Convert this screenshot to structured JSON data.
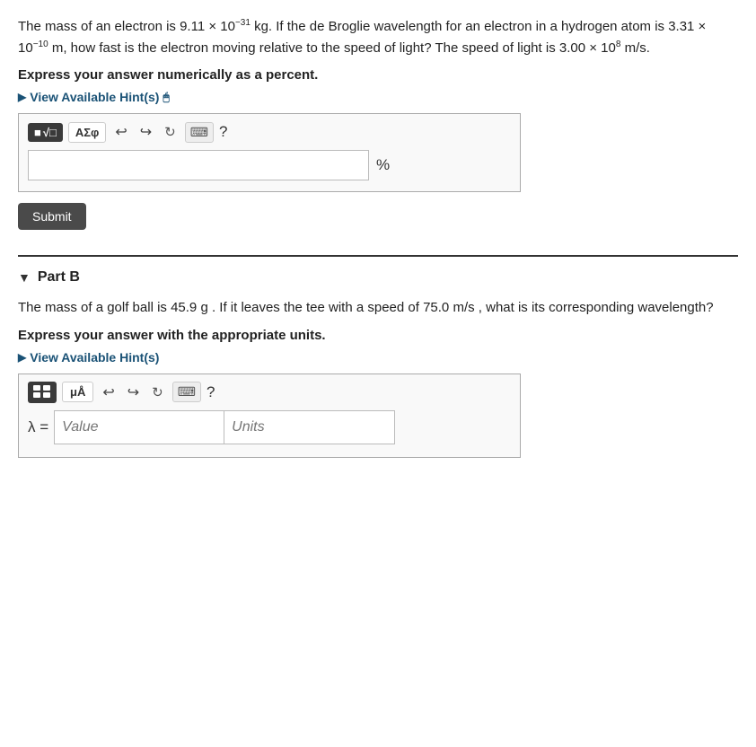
{
  "partA": {
    "problem_text_1": "The mass of an electron is 9.11 × 10",
    "exponent_1": "−31",
    "problem_text_2": " kg. If the de Broglie wavelength for an electron in a hydrogen atom is 3.31 × 10",
    "exponent_2": "−10",
    "problem_text_3": " m, how fast is the electron moving relative to the speed of light? The speed of light is 3.00 × 10",
    "exponent_3": "8",
    "problem_text_4": " m/s.",
    "instruction": "Express your answer numerically as a percent.",
    "hint_label": "View Available Hint(s)",
    "toolbar": {
      "sqrt_label": "√□",
      "greek_label": "ΑΣφ",
      "undo_icon": "↩",
      "redo_icon": "↪",
      "refresh_icon": "↻",
      "keyboard_icon": "⌨",
      "help_icon": "?"
    },
    "unit_symbol": "%",
    "submit_label": "Submit"
  },
  "partB": {
    "part_label": "Part B",
    "problem_text": "The mass of a golf ball is 45.9 g . If it leaves the tee with a speed of 75.0 m/s , what is its corresponding wavelength?",
    "instruction": "Express your answer with the appropriate units.",
    "hint_label": "View Available Hint(s)",
    "toolbar": {
      "matrix_icon": "grid",
      "mua_label": "μÅ",
      "undo_icon": "↩",
      "redo_icon": "↪",
      "refresh_icon": "↻",
      "keyboard_icon": "⌨",
      "help_icon": "?"
    },
    "lambda_label": "λ =",
    "value_placeholder": "Value",
    "units_placeholder": "Units"
  }
}
